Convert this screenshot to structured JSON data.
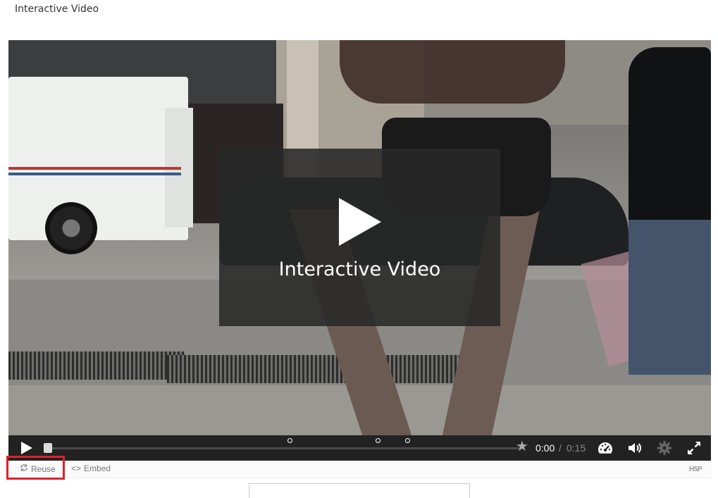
{
  "page": {
    "heading": "Interactive Video"
  },
  "video": {
    "splash_title": "Interactive Video",
    "progress": 0,
    "interaction_marker_fractions": [
      0.516,
      0.701,
      0.763
    ]
  },
  "controls": {
    "time_current": "0:00",
    "time_separator": "/",
    "time_total": "0:15"
  },
  "footer": {
    "reuse_label": "Reuse",
    "embed_label": "Embed",
    "embed_icon": "<>",
    "logo_text": "H5P"
  },
  "colors": {
    "control_bar": "#222222",
    "highlight": "#e0202a",
    "splash_overlay": "rgba(40,40,40,0.88)"
  },
  "icons": [
    "play-icon",
    "bookmark-star-icon",
    "playback-speed-icon",
    "volume-icon",
    "settings-icon",
    "fullscreen-icon",
    "reuse-icon",
    "embed-icon"
  ]
}
